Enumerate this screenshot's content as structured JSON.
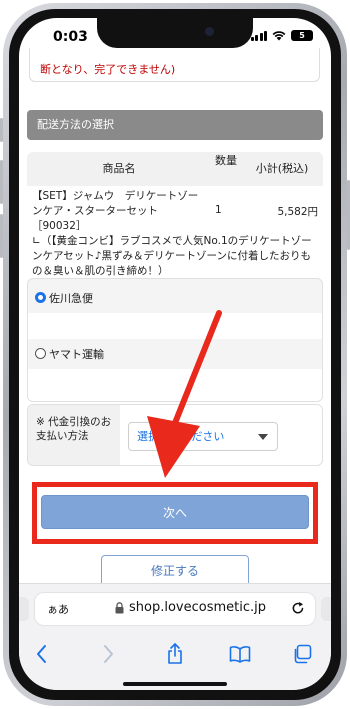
{
  "status_bar": {
    "time": "0:03",
    "battery": "5"
  },
  "notice": {
    "text": "断となり、完了できません)"
  },
  "shipping_section": {
    "title": "配送方法の選択"
  },
  "product_table": {
    "headers": {
      "name": "商品名",
      "quantity": "数量",
      "subtotal": "小計(税込)"
    },
    "rows": [
      {
        "name": "【SET】ジャムウ　デリケートゾーンケア・スターターセット［90032］",
        "quantity": "1",
        "price": "5,582円",
        "note": "∟（【黄金コンビ】ラブコスメで人気No.1のデリケートゾーンケアセット♪黒ずみ＆デリケートゾーンに付着したおりもの＆臭い＆肌の引き締め！）"
      }
    ]
  },
  "shipping_options": [
    {
      "label": "佐川急便",
      "selected": true
    },
    {
      "label": "ヤマト運輸",
      "selected": false
    }
  ],
  "payment": {
    "label": "※ 代金引換のお支払い方法",
    "select_value": "選択してください"
  },
  "buttons": {
    "next": "次へ",
    "fix": "修正する"
  },
  "browser": {
    "aa_label": "ぁあ",
    "url": "shop.lovecosmetic.jp"
  },
  "icons": {
    "back": "chevron-left-icon",
    "forward": "chevron-right-icon",
    "share": "share-icon",
    "bookmarks": "book-icon",
    "tabs": "tabs-icon",
    "reload": "reload-icon",
    "lock": "lock-icon"
  },
  "colors": {
    "accent_blue": "#1a73e8",
    "next_button": "#7fa4d8",
    "highlight_red": "#e8291c",
    "notice_red": "#c00000",
    "section_gray": "#8a8a8a"
  }
}
